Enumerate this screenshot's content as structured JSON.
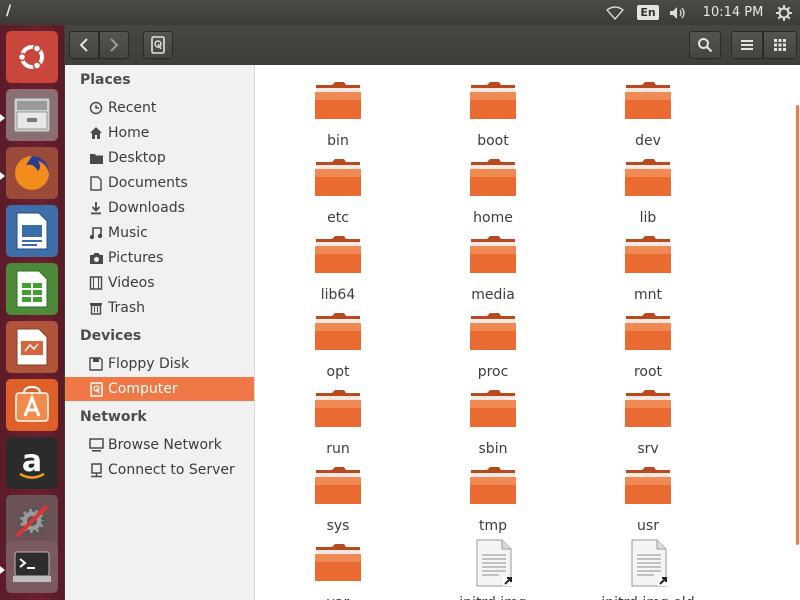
{
  "topbar": {
    "title": "/",
    "lang": "En",
    "clock": "10:14 PM"
  },
  "sidebar": {
    "places_label": "Places",
    "places": [
      {
        "label": "Recent",
        "icon": "clock-icon"
      },
      {
        "label": "Home",
        "icon": "home-icon"
      },
      {
        "label": "Desktop",
        "icon": "folder-icon"
      },
      {
        "label": "Documents",
        "icon": "document-icon"
      },
      {
        "label": "Downloads",
        "icon": "download-icon"
      },
      {
        "label": "Music",
        "icon": "music-icon"
      },
      {
        "label": "Pictures",
        "icon": "camera-icon"
      },
      {
        "label": "Videos",
        "icon": "film-icon"
      },
      {
        "label": "Trash",
        "icon": "trash-icon"
      }
    ],
    "devices_label": "Devices",
    "devices": [
      {
        "label": "Floppy Disk",
        "icon": "floppy-icon"
      },
      {
        "label": "Computer",
        "icon": "drive-icon",
        "selected": true
      }
    ],
    "network_label": "Network",
    "network": [
      {
        "label": "Browse Network",
        "icon": "network-icon"
      },
      {
        "label": "Connect to Server",
        "icon": "server-icon"
      }
    ]
  },
  "files": [
    {
      "name": "bin",
      "type": "folder"
    },
    {
      "name": "boot",
      "type": "folder"
    },
    {
      "name": "dev",
      "type": "folder"
    },
    {
      "name": "etc",
      "type": "folder"
    },
    {
      "name": "home",
      "type": "folder"
    },
    {
      "name": "lib",
      "type": "folder"
    },
    {
      "name": "lib64",
      "type": "folder"
    },
    {
      "name": "media",
      "type": "folder"
    },
    {
      "name": "mnt",
      "type": "folder"
    },
    {
      "name": "opt",
      "type": "folder"
    },
    {
      "name": "proc",
      "type": "folder"
    },
    {
      "name": "root",
      "type": "folder"
    },
    {
      "name": "run",
      "type": "folder"
    },
    {
      "name": "sbin",
      "type": "folder"
    },
    {
      "name": "srv",
      "type": "folder"
    },
    {
      "name": "sys",
      "type": "folder"
    },
    {
      "name": "tmp",
      "type": "folder"
    },
    {
      "name": "usr",
      "type": "folder"
    },
    {
      "name": "var",
      "type": "folder"
    },
    {
      "name": "initrd.img",
      "type": "link"
    },
    {
      "name": "initrd.img.old",
      "type": "link"
    }
  ],
  "colors": {
    "accent": "#f07746",
    "launcher": "#6b2030",
    "panel": "#3c3b37",
    "folder": "#e8672f"
  }
}
